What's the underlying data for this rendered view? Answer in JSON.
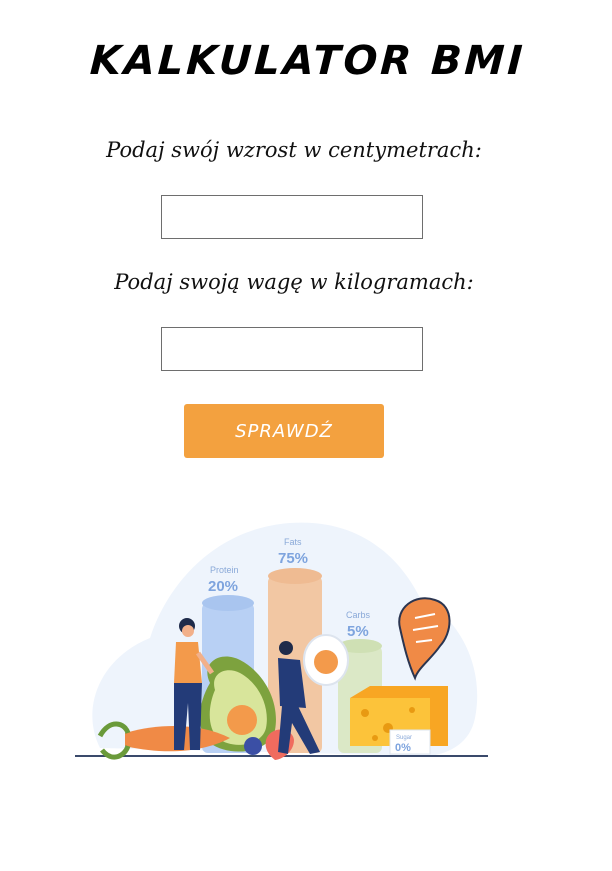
{
  "header": {
    "title": "KALKULATOR BMI"
  },
  "form": {
    "height_label": "Podaj swój wzrost w centymetrach:",
    "height_value": "",
    "weight_label": "Podaj swoją wagę w kilogramach:",
    "weight_value": "",
    "submit_label": "SPRAWDŹ"
  },
  "illustration": {
    "protein_label": "Protein",
    "protein_value": "20%",
    "fats_label": "Fats",
    "fats_value": "75%",
    "carbs_label": "Carbs",
    "carbs_value": "5%",
    "sugar_label": "Sugar",
    "sugar_value": "0%"
  },
  "colors": {
    "button": "#f3a13f",
    "protein_bar": "#b8d0f4",
    "fats_bar": "#f2c7a3",
    "carbs_bar": "#dbe8c6",
    "percent_text": "#7ea4de"
  }
}
